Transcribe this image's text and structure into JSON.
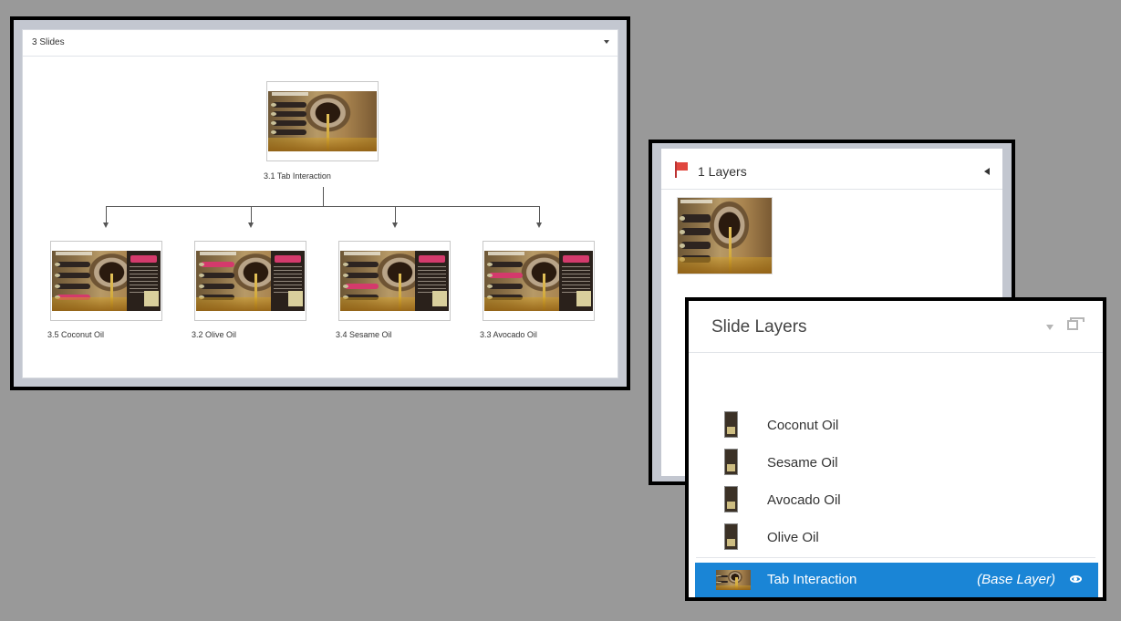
{
  "slides_panel": {
    "dropdown_label": "3 Slides",
    "root": {
      "label": "3.1 Tab Interaction"
    },
    "children": [
      {
        "label": "3.5 Coconut Oil"
      },
      {
        "label": "3.2 Olive Oil"
      },
      {
        "label": "3.4 Sesame Oil"
      },
      {
        "label": "3.3 Avocado Oil"
      }
    ]
  },
  "layers_panel": {
    "header_label": "1 Layers",
    "flag_color": "#e0463e"
  },
  "slide_layers": {
    "title": "Slide Layers",
    "layers": [
      {
        "name": "Coconut Oil"
      },
      {
        "name": "Sesame Oil"
      },
      {
        "name": "Avocado Oil"
      },
      {
        "name": "Olive Oil"
      }
    ],
    "base_layer": {
      "name": "Tab Interaction",
      "tag": "(Base Layer)",
      "highlight_color": "#1a85d6"
    }
  }
}
